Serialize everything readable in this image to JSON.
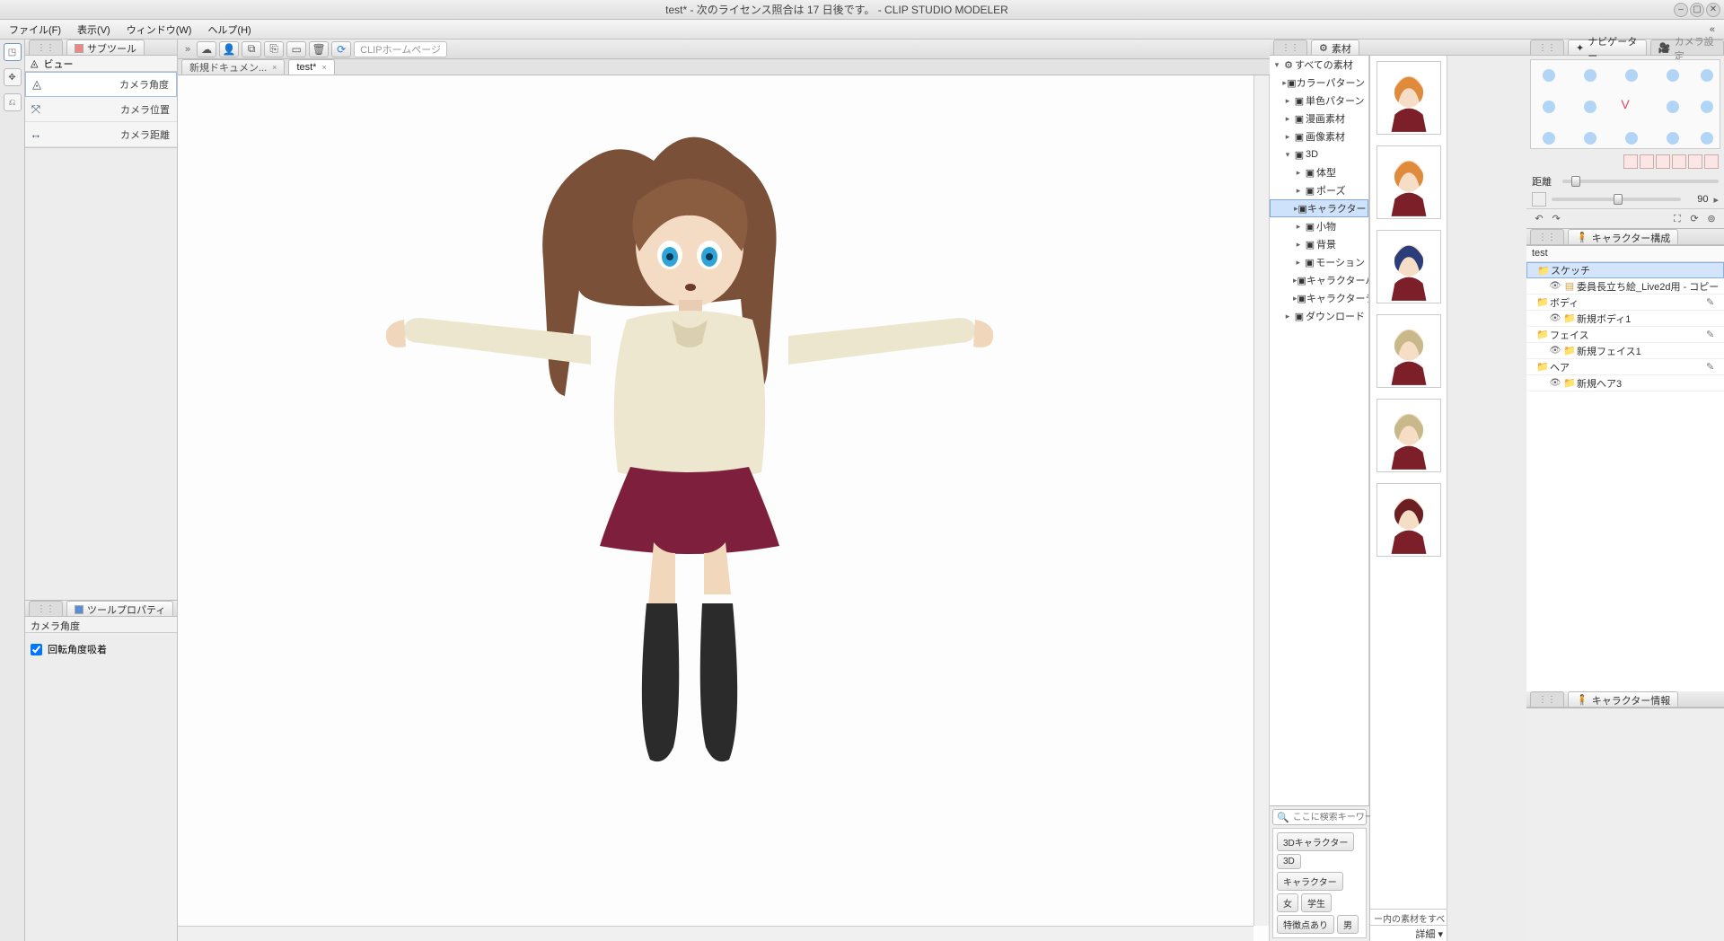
{
  "title": "test*  - 次のライセンス照合は 17 日後です。 - CLIP STUDIO MODELER",
  "menus": {
    "file": "ファイル(F)",
    "view": "表示(V)",
    "window": "ウィンドウ(W)",
    "help": "ヘルプ(H)"
  },
  "toolbar": {
    "search_placeholder": "CLIPホームページ"
  },
  "leftTabs": {
    "subtool": "サブツール"
  },
  "subtool": {
    "header": "ビュー",
    "items": [
      {
        "label": "カメラ角度",
        "sel": true
      },
      {
        "label": "カメラ位置"
      },
      {
        "label": "カメラ距離"
      }
    ]
  },
  "toolprop": {
    "tab": "ツールプロパティ",
    "title": "カメラ角度",
    "opt1": "回転角度吸着"
  },
  "docTabs": [
    {
      "label": "新規ドキュメン...",
      "active": false
    },
    {
      "label": "test*",
      "active": true
    }
  ],
  "material": {
    "tab": "素材",
    "root": "すべての素材",
    "nodes": [
      {
        "label": "カラーパターン",
        "lvl": 1
      },
      {
        "label": "単色パターン",
        "lvl": 1
      },
      {
        "label": "漫画素材",
        "lvl": 1
      },
      {
        "label": "画像素材",
        "lvl": 1
      },
      {
        "label": "3D",
        "lvl": 1,
        "open": true
      },
      {
        "label": "体型",
        "lvl": 2
      },
      {
        "label": "ポーズ",
        "lvl": 2
      },
      {
        "label": "キャラクター",
        "lvl": 2,
        "sel": true
      },
      {
        "label": "小物",
        "lvl": 2
      },
      {
        "label": "背景",
        "lvl": 2
      },
      {
        "label": "モーション",
        "lvl": 2
      },
      {
        "label": "キャラクターパーツ",
        "lvl": 2
      },
      {
        "label": "キャラクターテクス",
        "lvl": 2
      },
      {
        "label": "ダウンロード",
        "lvl": 1
      }
    ],
    "search_placeholder": "ここに検索キーワー…",
    "tags": [
      "3Dキャラクター",
      "3D",
      "キャラクター",
      "女",
      "学生",
      "特徴点あり",
      "男"
    ],
    "footer": "ー内の素材をすべ",
    "detail": "詳細 ▾"
  },
  "nav": {
    "tab": "ナビゲーター",
    "tab2": "カメラ設定",
    "distance_label": "距離",
    "angle_value": "90"
  },
  "charComp": {
    "tab": "キャラクター構成",
    "title": "test",
    "rows": [
      {
        "name": "スケッチ",
        "lvl": 1,
        "folder": true,
        "sel": true
      },
      {
        "name": "委員長立ち絵_Live2d用 - コピー",
        "lvl": 2,
        "eye": true
      },
      {
        "name": "ボディ",
        "lvl": 1,
        "folder": true,
        "wand": true
      },
      {
        "name": "新規ボディ1",
        "lvl": 2,
        "folder": true,
        "eye": true
      },
      {
        "name": "フェイス",
        "lvl": 1,
        "folder": true,
        "wand": true
      },
      {
        "name": "新規フェイス1",
        "lvl": 2,
        "folder": true,
        "eye": true
      },
      {
        "name": "ヘア",
        "lvl": 1,
        "folder": true,
        "wand": true
      },
      {
        "name": "新規ヘア3",
        "lvl": 2,
        "folder": true,
        "eye": true
      }
    ]
  },
  "charInfo": {
    "tab": "キャラクター情報"
  }
}
